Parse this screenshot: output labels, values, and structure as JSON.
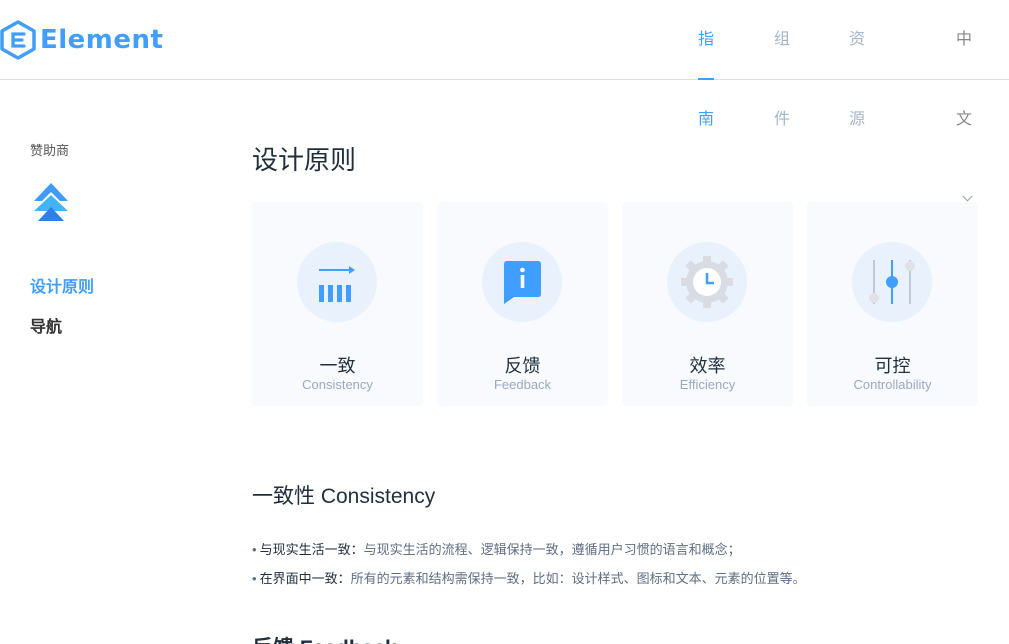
{
  "header": {
    "logo_text": "Element",
    "nav": [
      {
        "label": "指南",
        "active": true
      },
      {
        "label": "组件",
        "active": false
      },
      {
        "label": "资源",
        "active": false
      }
    ],
    "language": "中文",
    "accent": "#409eff"
  },
  "sidebar": {
    "sponsor_title": "赞助商",
    "links": [
      {
        "label": "设计原则",
        "active": true
      },
      {
        "label": "导航",
        "active": false
      }
    ]
  },
  "main": {
    "title": "设计原则",
    "cards": [
      {
        "title": "一致",
        "subtitle": "Consistency",
        "icon": "consistency-icon"
      },
      {
        "title": "反馈",
        "subtitle": "Feedback",
        "icon": "feedback-icon"
      },
      {
        "title": "效率",
        "subtitle": "Efficiency",
        "icon": "efficiency-icon"
      },
      {
        "title": "可控",
        "subtitle": "Controllability",
        "icon": "controllability-icon"
      }
    ],
    "section": {
      "title": "一致性 Consistency",
      "bullets": [
        {
          "label": "与现实生活一致：",
          "text": "与现实生活的流程、逻辑保持一致，遵循用户习惯的语言和概念；"
        },
        {
          "label": "在界面中一致：",
          "text": "所有的元素和结构需保持一致，比如：设计样式、图标和文本、元素的位置等。"
        }
      ]
    },
    "next_section_title": "反馈 Feedback"
  }
}
